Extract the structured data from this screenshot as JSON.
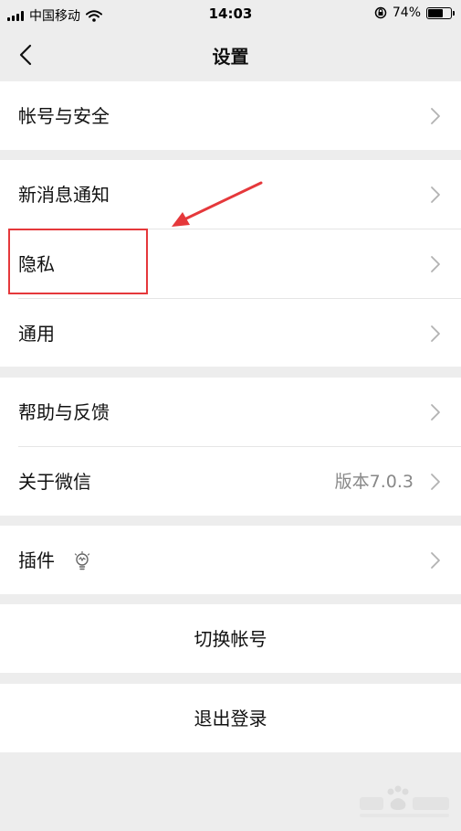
{
  "status_bar": {
    "carrier": "中国移动",
    "time": "14:03",
    "battery": "74%",
    "battery_level": 0.74
  },
  "nav": {
    "title": "设置",
    "back_icon": "chevron-left-icon"
  },
  "groups": {
    "account": {
      "label": "帐号与安全"
    },
    "notifications": {
      "label": "新消息通知"
    },
    "privacy": {
      "label": "隐私"
    },
    "general": {
      "label": "通用"
    },
    "help": {
      "label": "帮助与反馈"
    },
    "about": {
      "label": "关于微信",
      "value": "版本7.0.3"
    },
    "plugins": {
      "label": "插件",
      "icon": "lightbulb-icon"
    },
    "switch_account": {
      "label": "切换帐号"
    },
    "logout": {
      "label": "退出登录"
    }
  },
  "annotation": {
    "highlight_color": "#e5383b"
  }
}
